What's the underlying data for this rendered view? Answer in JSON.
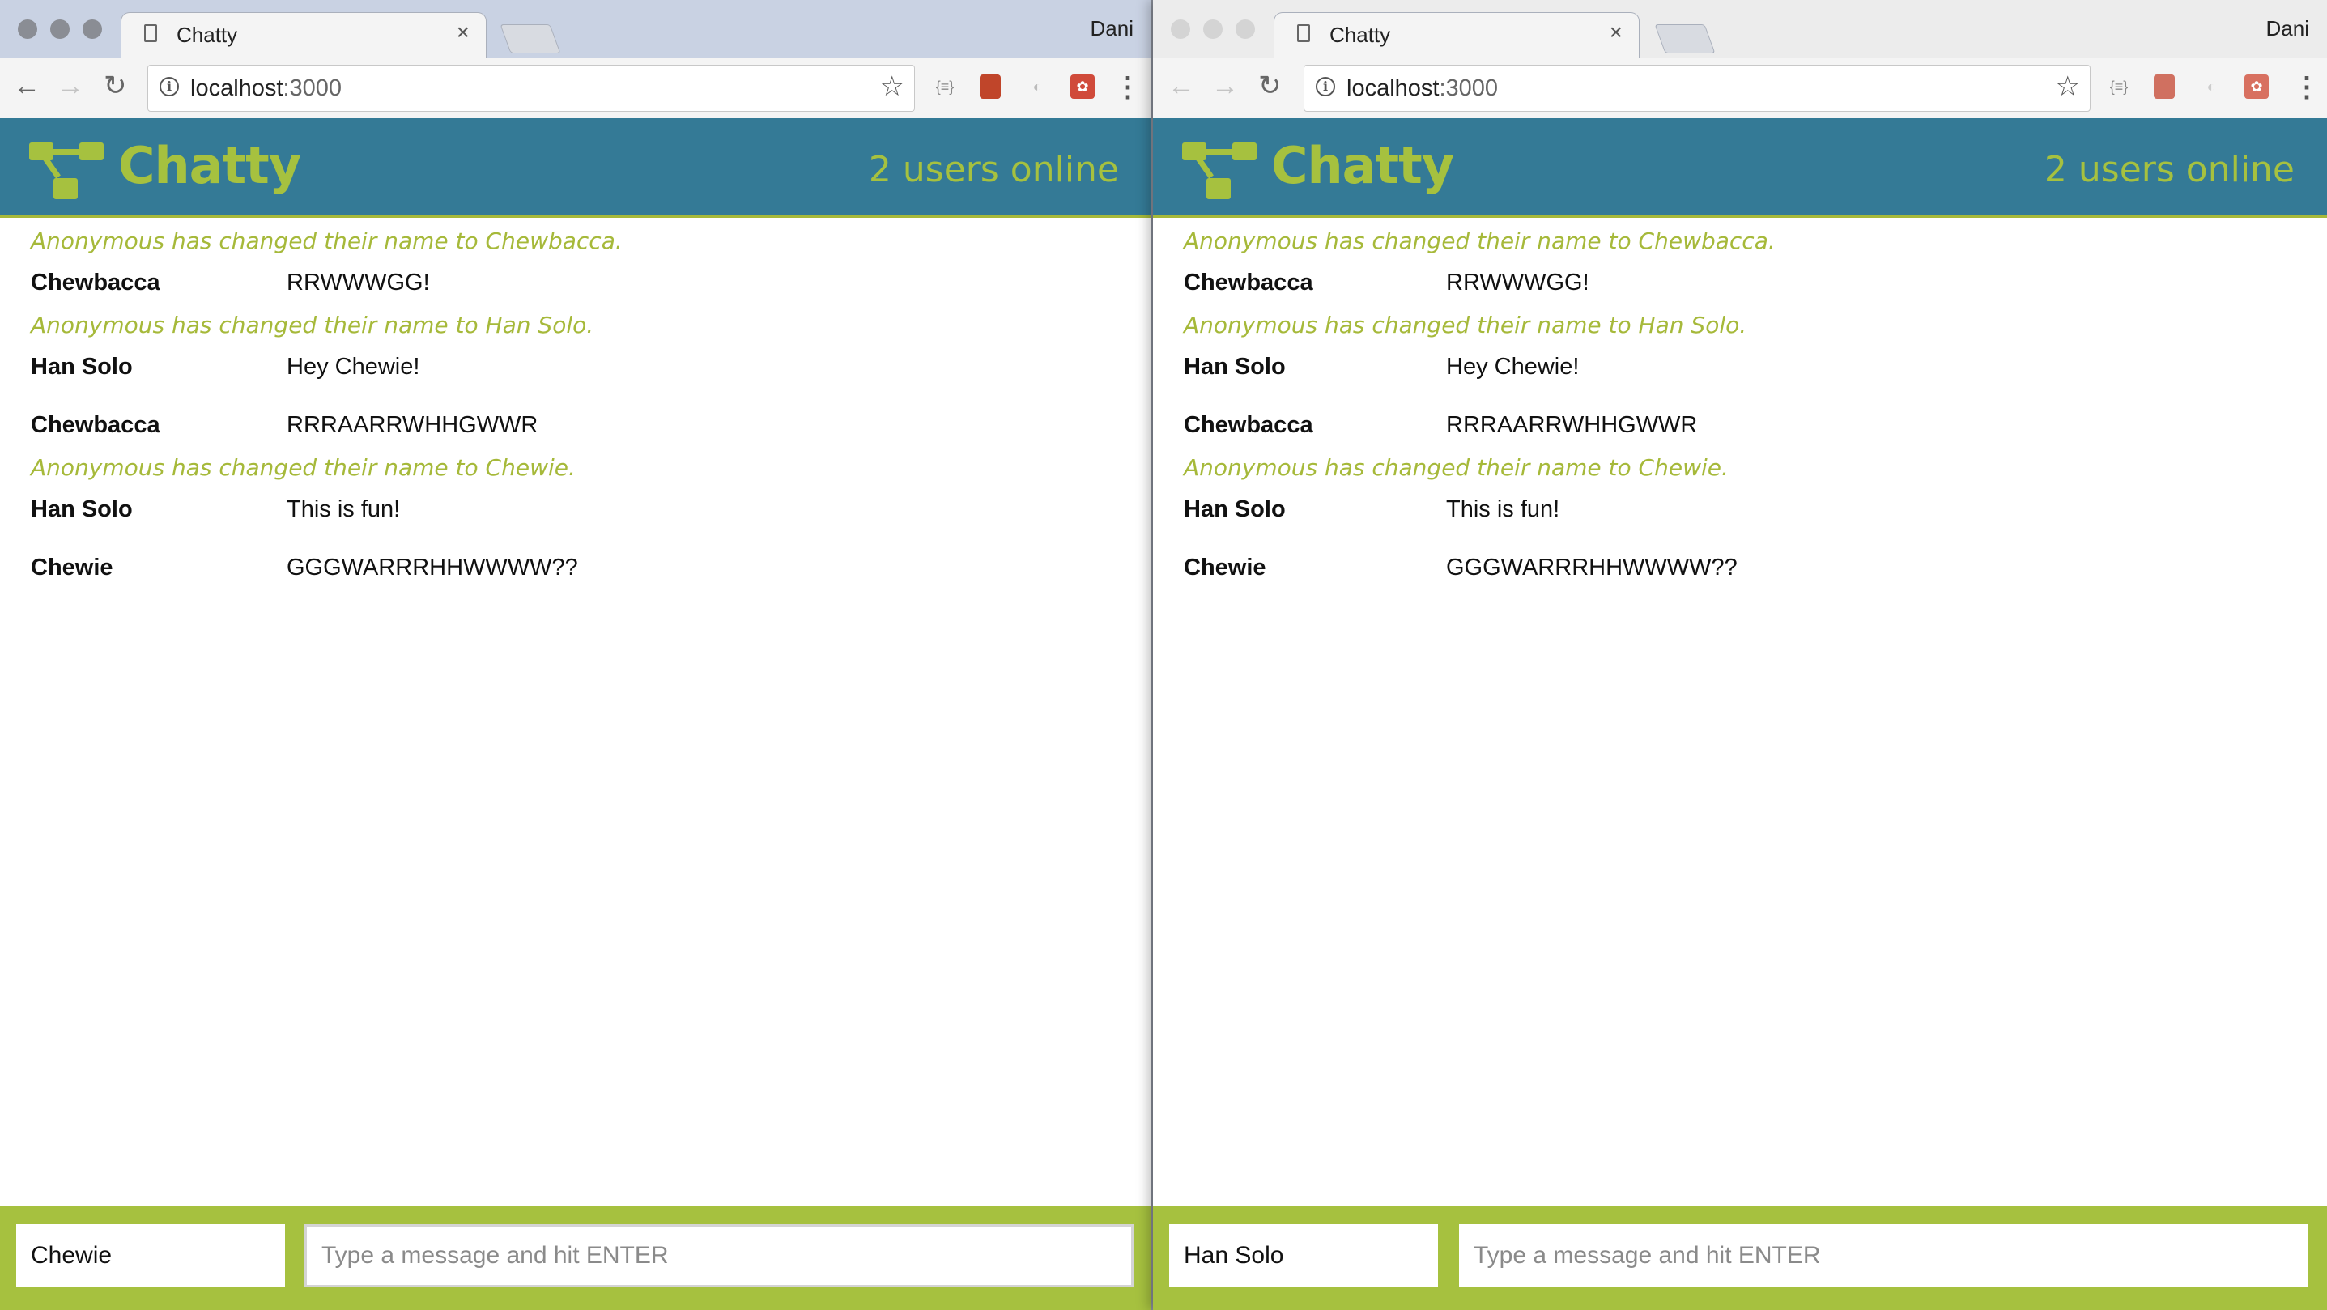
{
  "colors": {
    "header_bg": "#347a96",
    "accent": "#a6c13f",
    "system_text": "#a6b93a"
  },
  "windows": [
    {
      "tab_title": "Chatty",
      "profile": "Dani",
      "url_host": "localhost",
      "url_port": ":3000",
      "app_title": "Chatty",
      "users_online": "2 users online",
      "messages": [
        {
          "type": "system",
          "text": "Anonymous has changed their name to Chewbacca."
        },
        {
          "type": "message",
          "username": "Chewbacca",
          "content": "RRWWWGG!"
        },
        {
          "type": "system",
          "text": "Anonymous has changed their name to Han Solo."
        },
        {
          "type": "message",
          "username": "Han Solo",
          "content": "Hey Chewie!"
        },
        {
          "type": "message",
          "username": "Chewbacca",
          "content": "RRRAARRWHHGWWR"
        },
        {
          "type": "system",
          "text": "Anonymous has changed their name to Chewie."
        },
        {
          "type": "message",
          "username": "Han Solo",
          "content": "This is fun!"
        },
        {
          "type": "message",
          "username": "Chewie",
          "content": "GGGWARRRHHWWWW??"
        }
      ],
      "name_value": "Chewie",
      "message_placeholder": "Type a message and hit ENTER"
    },
    {
      "tab_title": "Chatty",
      "profile": "Dani",
      "url_host": "localhost",
      "url_port": ":3000",
      "app_title": "Chatty",
      "users_online": "2 users online",
      "messages": [
        {
          "type": "system",
          "text": "Anonymous has changed their name to Chewbacca."
        },
        {
          "type": "message",
          "username": "Chewbacca",
          "content": "RRWWWGG!"
        },
        {
          "type": "system",
          "text": "Anonymous has changed their name to Han Solo."
        },
        {
          "type": "message",
          "username": "Han Solo",
          "content": "Hey Chewie!"
        },
        {
          "type": "message",
          "username": "Chewbacca",
          "content": "RRRAARRWHHGWWR"
        },
        {
          "type": "system",
          "text": "Anonymous has changed their name to Chewie."
        },
        {
          "type": "message",
          "username": "Han Solo",
          "content": "This is fun!"
        },
        {
          "type": "message",
          "username": "Chewie",
          "content": "GGGWARRRHHWWWW??"
        }
      ],
      "name_value": "Han Solo",
      "message_placeholder": "Type a message and hit ENTER"
    }
  ]
}
